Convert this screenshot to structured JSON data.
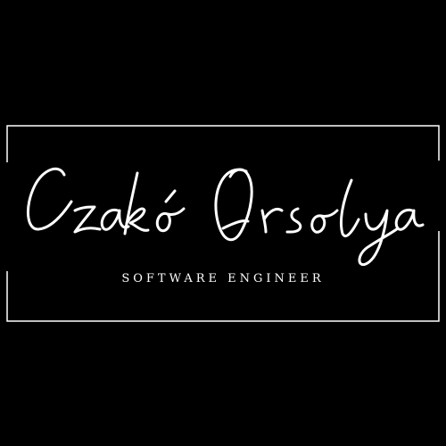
{
  "logo": {
    "name": "Czakó Orsolya",
    "subtitle": "SOFTWARE ENGINEER"
  },
  "colors": {
    "background": "#000000",
    "foreground": "#ffffff"
  }
}
